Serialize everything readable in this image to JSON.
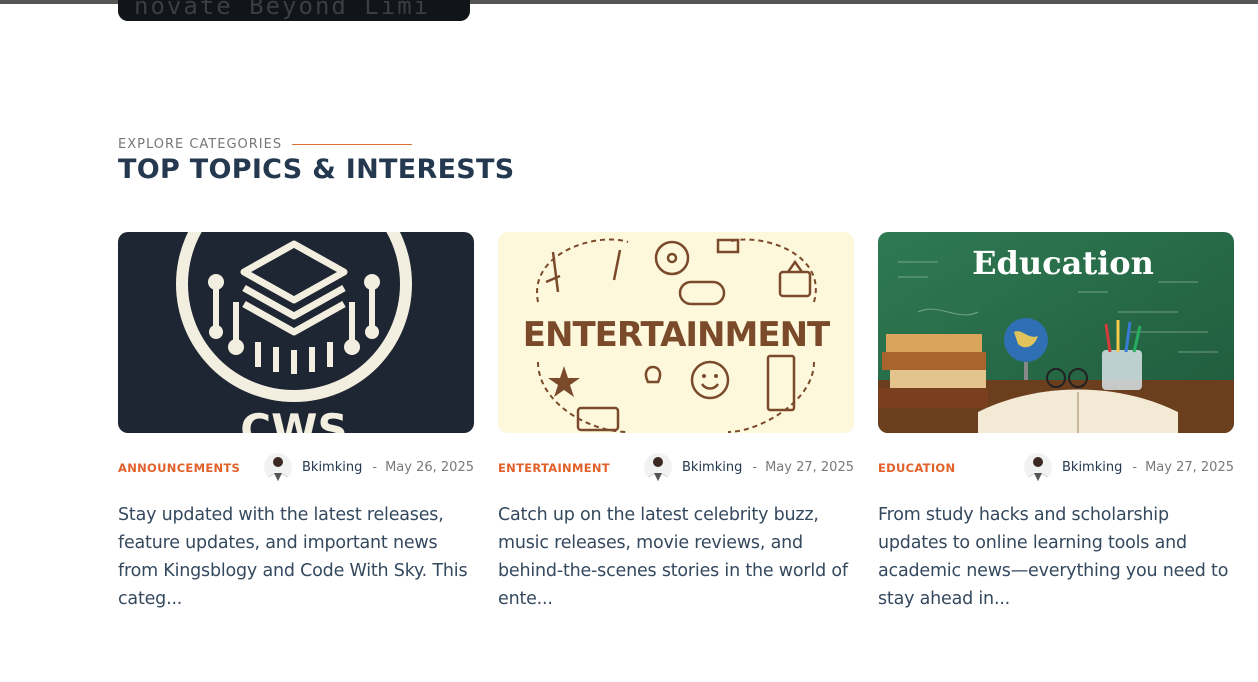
{
  "previous_card": {
    "banner_text": "novate Beyond Limi"
  },
  "section": {
    "eyebrow": "EXPLORE CATEGORIES",
    "title": "TOP TOPICS & INTERESTS"
  },
  "cards": [
    {
      "image_text": "CWS",
      "category": "ANNOUNCEMENTS",
      "author": "Bkimking",
      "date_sep": "-",
      "date": "May 26, 2025",
      "excerpt": "Stay updated with the latest releases, feature updates, and important news from Kingsblogy and Code With Sky. This categ..."
    },
    {
      "image_text": "ENTERTAINMENT",
      "category": "ENTERTAINMENT",
      "author": "Bkimking",
      "date_sep": "-",
      "date": "May 27, 2025",
      "excerpt": "Catch up on the latest celebrity buzz, music releases, movie reviews, and behind-the-scenes stories in the world of ente..."
    },
    {
      "image_text": "Education",
      "category": "EDUCATION",
      "author": "Bkimking",
      "date_sep": "-",
      "date": "May 27, 2025",
      "excerpt": "From study hacks and scholarship updates to online learning tools and academic news—everything you need to stay ahead in..."
    }
  ],
  "colors": {
    "accent": "#e2612a",
    "heading": "#24384f",
    "cws_bg": "#1e2633",
    "entertainment_bg": "#fdf8dc",
    "entertainment_ink": "#7a4a2a",
    "education_bg": "#2f7a55"
  }
}
